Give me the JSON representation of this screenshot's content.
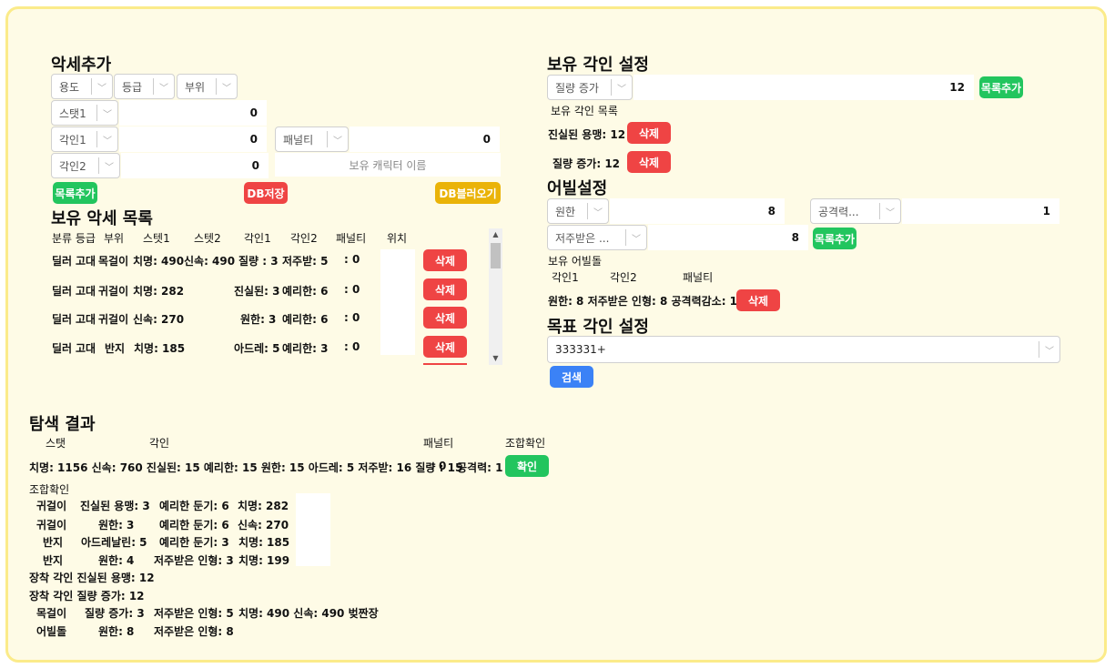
{
  "left": {
    "add_title": "악세추가",
    "selects": {
      "usage": "용도",
      "grade": "등급",
      "part": "부위",
      "stat1": "스탯1",
      "engrave1": "각인1",
      "engrave2": "각인2",
      "penalty": "패널티"
    },
    "values": {
      "stat1": "0",
      "engrave1": "0",
      "engrave2": "0",
      "penalty": "0"
    },
    "char_name_placeholder": "보유 캐릭터 이름",
    "buttons": {
      "add": "목록추가",
      "db_save": "DB저장",
      "db_load": "DB블러오기"
    },
    "list_title": "보유 악세 목록",
    "list_headers": [
      "분류 등급",
      "부위",
      "스텟1",
      "스텟2",
      "각인1",
      "각인2",
      "패널티",
      "위치"
    ],
    "rows": [
      {
        "class": "딜러",
        "grade": "고대",
        "part": "목걸이",
        "stat1": "치명: 490",
        "stat2": "신속: 490",
        "engrave1": "질량 : 3",
        "engrave2": "저주받: 5",
        "penalty": ": 0",
        "delete": "삭제"
      },
      {
        "class": "딜러",
        "grade": "고대",
        "part": "귀걸이",
        "stat1": "치명: 282",
        "stat2": "",
        "engrave1": "진실된: 3",
        "engrave2": "예리한: 6",
        "penalty": ": 0",
        "delete": "삭제"
      },
      {
        "class": "딜러",
        "grade": "고대",
        "part": "귀걸이",
        "stat1": "신속: 270",
        "stat2": "",
        "engrave1": "원한: 3",
        "engrave2": "예리한: 6",
        "penalty": ": 0",
        "delete": "삭제"
      },
      {
        "class": "딜러",
        "grade": "고대",
        "part": "반지",
        "stat1": "치명: 185",
        "stat2": "",
        "engrave1": "아드레: 5",
        "engrave2": "예리한: 3",
        "penalty": ": 0",
        "delete": "삭제"
      }
    ]
  },
  "right": {
    "owned_title": "보유 각인 설정",
    "owned_select": "질량 증가",
    "owned_value": "12",
    "owned_add": "목록추가",
    "owned_list_label": "보유 각인 목록",
    "owned_items": [
      {
        "text": "진실된 용맹: 12",
        "delete": "삭제"
      },
      {
        "text": "질량 증가: 12",
        "delete": "삭제"
      }
    ],
    "ability_title": "어빌설정",
    "ability_sel1": "원한",
    "ability_val1": "8",
    "ability_sel2": "공격력...",
    "ability_val2": "1",
    "ability_sel3": "저주받은 ...",
    "ability_val3": "8",
    "ability_add": "목록추가",
    "ability_owned_label": "보유 어빌돌",
    "ability_headers": [
      "각인1",
      "각인2",
      "패널티"
    ],
    "ability_row": "원한: 8 저주받은 인형: 8 공격력감소: 1",
    "ability_delete": "삭제",
    "target_title": "목표 각인 설정",
    "target_value": "333331+",
    "search": "검색"
  },
  "result": {
    "title": "탐색 결과",
    "headers": {
      "stat": "스탯",
      "engrave": "각인",
      "penalty": "패널티",
      "check": "조합확인"
    },
    "summary": "치명: 1156 신속: 760 진실된: 15 예리한: 15 원한: 15 아드레: 5 저주받: 16 질량 : 15",
    "summary_penalty": ": 0",
    "summary_attack": "공격력: 1",
    "confirm": "확인",
    "combo_label": "조합확인",
    "combo_rows": [
      {
        "part": "귀걸이",
        "e1": "진실된 용맹: 3",
        "e2": "예리한 둔기: 6",
        "stat": "치명: 282"
      },
      {
        "part": "귀걸이",
        "e1": "원한: 3",
        "e2": "예리한 둔기: 6",
        "stat": "신속: 270"
      },
      {
        "part": "반지",
        "e1": "아드레날린: 5",
        "e2": "예리한 둔기: 3",
        "stat": "치명: 185"
      },
      {
        "part": "반지",
        "e1": "원한: 4",
        "e2": "저주받은 인형: 3",
        "stat": "치명: 199"
      }
    ],
    "equip1": "장착 각인 진실된 용맹: 12",
    "equip2": "장착 각인  질량 증가: 12",
    "necklace": {
      "part": "목걸이",
      "e1": "질량 증가: 3",
      "e2": "저주받은 인형: 5",
      "stat": "치명: 490 신속: 490 벚짠장"
    },
    "stone": {
      "part": "어빌돌",
      "e1": "원한: 8",
      "e2": "저주받은 인형: 8"
    }
  }
}
